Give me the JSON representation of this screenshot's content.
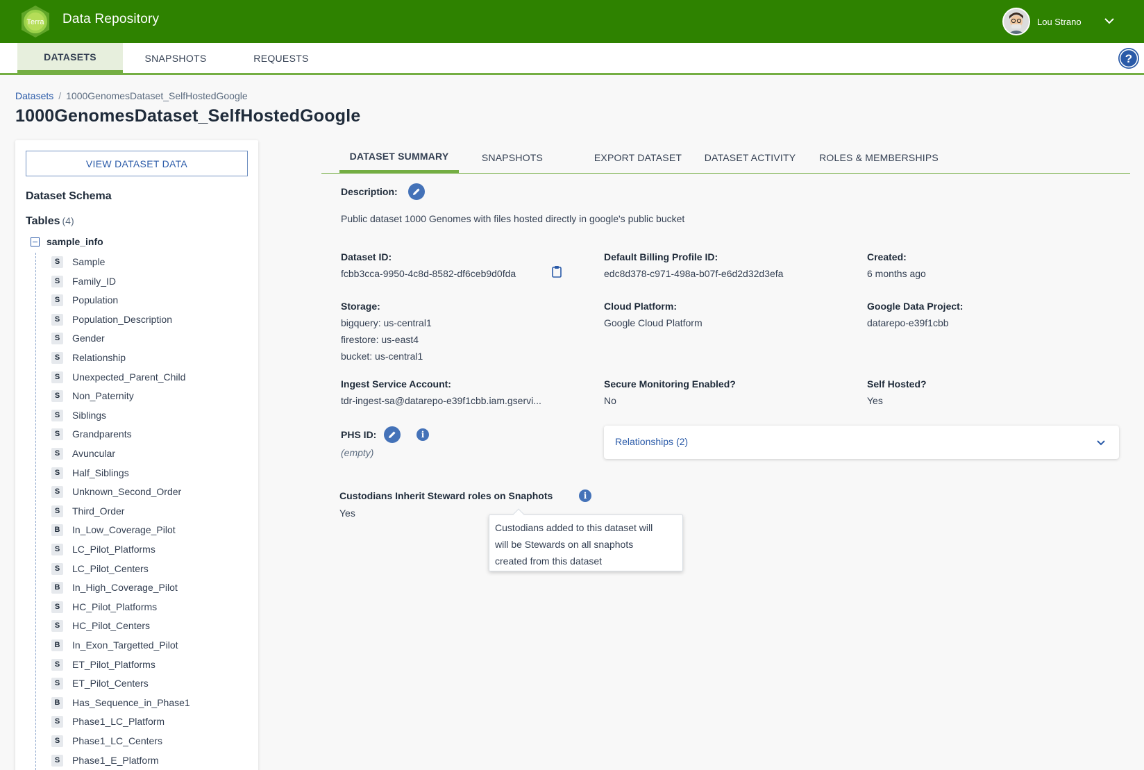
{
  "header": {
    "logo_text": "Terra",
    "app_title": "Data Repository",
    "user_name": "Lou Strano"
  },
  "main_nav": {
    "tabs": [
      {
        "label": "DATASETS",
        "active": true
      },
      {
        "label": "SNAPSHOTS",
        "active": false
      },
      {
        "label": "REQUESTS",
        "active": false
      }
    ]
  },
  "breadcrumb": {
    "root": "Datasets",
    "separator": "/",
    "current": "1000GenomesDataset_SelfHostedGoogle"
  },
  "page_title": "1000GenomesDataset_SelfHostedGoogle",
  "sidebar": {
    "view_data_button": "VIEW DATASET DATA",
    "schema_title": "Dataset Schema",
    "tables_label": "Tables",
    "tables_count": "(4)",
    "table": {
      "name": "sample_info",
      "columns": [
        {
          "type": "S",
          "name": "Sample"
        },
        {
          "type": "S",
          "name": "Family_ID"
        },
        {
          "type": "S",
          "name": "Population"
        },
        {
          "type": "S",
          "name": "Population_Description"
        },
        {
          "type": "S",
          "name": "Gender"
        },
        {
          "type": "S",
          "name": "Relationship"
        },
        {
          "type": "S",
          "name": "Unexpected_Parent_Child"
        },
        {
          "type": "S",
          "name": "Non_Paternity"
        },
        {
          "type": "S",
          "name": "Siblings"
        },
        {
          "type": "S",
          "name": "Grandparents"
        },
        {
          "type": "S",
          "name": "Avuncular"
        },
        {
          "type": "S",
          "name": "Half_Siblings"
        },
        {
          "type": "S",
          "name": "Unknown_Second_Order"
        },
        {
          "type": "S",
          "name": "Third_Order"
        },
        {
          "type": "B",
          "name": "In_Low_Coverage_Pilot"
        },
        {
          "type": "S",
          "name": "LC_Pilot_Platforms"
        },
        {
          "type": "S",
          "name": "LC_Pilot_Centers"
        },
        {
          "type": "B",
          "name": "In_High_Coverage_Pilot"
        },
        {
          "type": "S",
          "name": "HC_Pilot_Platforms"
        },
        {
          "type": "S",
          "name": "HC_Pilot_Centers"
        },
        {
          "type": "B",
          "name": "In_Exon_Targetted_Pilot"
        },
        {
          "type": "S",
          "name": "ET_Pilot_Platforms"
        },
        {
          "type": "S",
          "name": "ET_Pilot_Centers"
        },
        {
          "type": "B",
          "name": "Has_Sequence_in_Phase1"
        },
        {
          "type": "S",
          "name": "Phase1_LC_Platform"
        },
        {
          "type": "S",
          "name": "Phase1_LC_Centers"
        },
        {
          "type": "S",
          "name": "Phase1_E_Platform"
        }
      ]
    }
  },
  "detail_tabs": [
    {
      "label": "DATASET SUMMARY",
      "active": true
    },
    {
      "label": "SNAPSHOTS",
      "active": false
    },
    {
      "label": "EXPORT DATASET",
      "active": false
    },
    {
      "label": "DATASET ACTIVITY",
      "active": false
    },
    {
      "label": "ROLES & MEMBERSHIPS",
      "active": false
    }
  ],
  "summary": {
    "description_label": "Description:",
    "description": "Public dataset 1000 Genomes with files hosted directly in google's public bucket",
    "dataset_id_label": "Dataset ID:",
    "dataset_id": "fcbb3cca-9950-4c8d-8582-df6ceb9d0fda",
    "billing_label": "Default Billing Profile ID:",
    "billing_id": "edc8d378-c971-498a-b07f-e6d2d32d3efa",
    "created_label": "Created:",
    "created": "6 months ago",
    "storage_label": "Storage:",
    "storage": [
      "bigquery: us-central1",
      "firestore: us-east4",
      "bucket: us-central1"
    ],
    "cloud_label": "Cloud Platform:",
    "cloud": "Google Cloud Platform",
    "project_label": "Google Data Project:",
    "project": "datarepo-e39f1cbb",
    "ingest_label": "Ingest Service Account:",
    "ingest": "tdr-ingest-sa@datarepo-e39f1cbb.iam.gservi...",
    "secure_label": "Secure Monitoring Enabled?",
    "secure": "No",
    "selfhosted_label": "Self Hosted?",
    "selfhosted": "Yes",
    "phs_label": "PHS ID:",
    "phs": "(empty)",
    "relationships_label": "Relationships (2)",
    "custodians_label": "Custodians Inherit Steward roles on Snaphots",
    "custodians": "Yes",
    "tooltip": [
      "Custodians added to this dataset will",
      "will be Stewards on all snaphots",
      "created from this dataset"
    ]
  },
  "colors": {
    "header_green": "#2e8200",
    "accent_green": "#74ae43",
    "link_blue": "#2a5aa8",
    "icon_blue": "#4472b8"
  },
  "icons": {
    "logo": "terra-logo-icon",
    "user_menu": "chevron-down-icon",
    "help": "help-icon",
    "edit": "pencil-icon",
    "info": "info-icon",
    "copy": "clipboard-icon"
  }
}
